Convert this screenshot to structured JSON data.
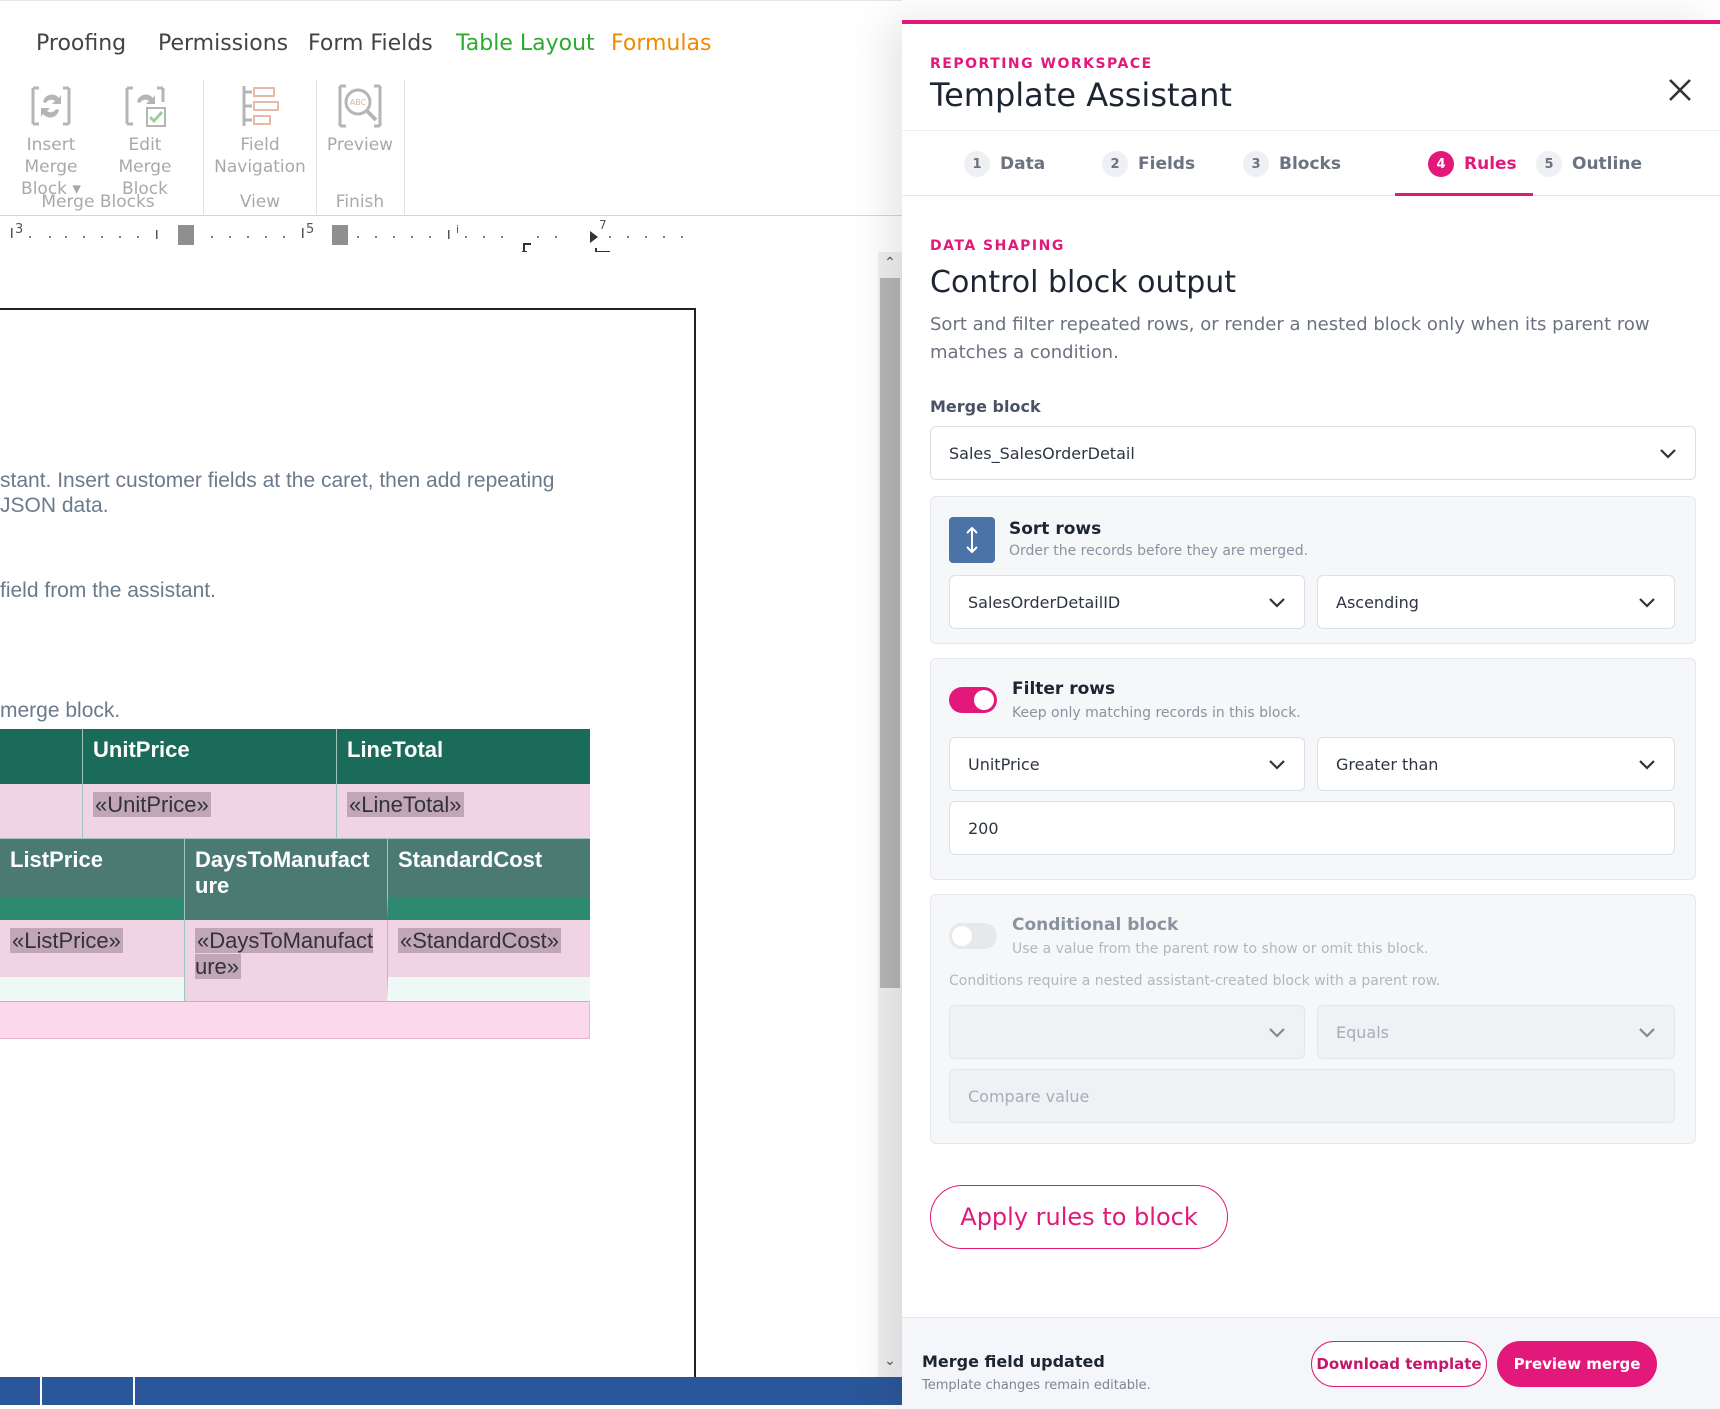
{
  "ribbon": {
    "tabs": [
      {
        "label": "Proofing"
      },
      {
        "label": "Permissions"
      },
      {
        "label": "Form Fields"
      },
      {
        "label": "Table Layout",
        "color": "#2eaa2e"
      },
      {
        "label": "Formulas",
        "color": "#f08a00"
      }
    ],
    "buttons": {
      "insert_merge_block": {
        "line1": "Insert Merge",
        "line2": "Block ▾"
      },
      "edit_merge_block": {
        "line1": "Edit Merge",
        "line2": "Block"
      },
      "field_navigation": {
        "line1": "Field",
        "line2": "Navigation"
      },
      "preview": {
        "line1": "Preview"
      }
    },
    "groups": {
      "merge_blocks": "Merge Blocks",
      "view": "View",
      "finish": "Finish"
    }
  },
  "ruler": {
    "marks": [
      "3",
      "5",
      "i",
      "7"
    ]
  },
  "document": {
    "para1_line1": "stant. Insert customer fields at the caret, then add repeating",
    "para1_line2": " JSON data.",
    "para2": "field from the assistant.",
    "para3": "merge block.",
    "table1": {
      "headers": [
        "UnitPrice",
        "LineTotal"
      ],
      "fields": [
        "«UnitPrice»",
        "«LineTotal»"
      ]
    },
    "table2": {
      "headers": [
        "ListPrice",
        "DaysToManufact\nure",
        "StandardCost"
      ],
      "fields": [
        "«ListPrice»",
        "«DaysToManufact\nure»",
        "«StandardCost»"
      ]
    }
  },
  "assistant": {
    "eyebrow": "REPORTING WORKSPACE",
    "title": "Template Assistant",
    "close_icon": "close-icon",
    "tabs": [
      {
        "num": "1",
        "label": "Data"
      },
      {
        "num": "2",
        "label": "Fields"
      },
      {
        "num": "3",
        "label": "Blocks"
      },
      {
        "num": "4",
        "label": "Rules",
        "active": true
      },
      {
        "num": "5",
        "label": "Outline"
      }
    ],
    "section_eyebrow": "DATA SHAPING",
    "section_title": "Control block output",
    "description": "Sort and filter repeated rows, or render a nested block only when its parent row matches a condition.",
    "merge_block_label": "Merge block",
    "merge_block_value": "Sales_SalesOrderDetail",
    "sort": {
      "title": "Sort rows",
      "subtitle": "Order the records before they are merged.",
      "field": "SalesOrderDetailID",
      "direction": "Ascending"
    },
    "filter": {
      "title": "Filter rows",
      "subtitle": "Keep only matching records in this block.",
      "enabled": true,
      "field": "UnitPrice",
      "operator": "Greater than",
      "value": "200"
    },
    "conditional": {
      "title": "Conditional block",
      "subtitle": "Use a value from the parent row to show or omit this block.",
      "enabled": false,
      "note": "Conditions require a nested assistant-created block with a parent row.",
      "field": "",
      "operator": "Equals",
      "compare_placeholder": "Compare value"
    },
    "apply_label": "Apply rules to block",
    "footer": {
      "status_title": "Merge field updated",
      "status_sub": "Template changes remain editable.",
      "download_label": "Download template",
      "preview_label": "Preview merge"
    }
  },
  "colors": {
    "accent": "#e2197a",
    "table_header": "#1a6b5a",
    "table_header2": "#4a7a72",
    "table_field_bg": "#f1d4e4",
    "statusbar": "#2b579a"
  }
}
